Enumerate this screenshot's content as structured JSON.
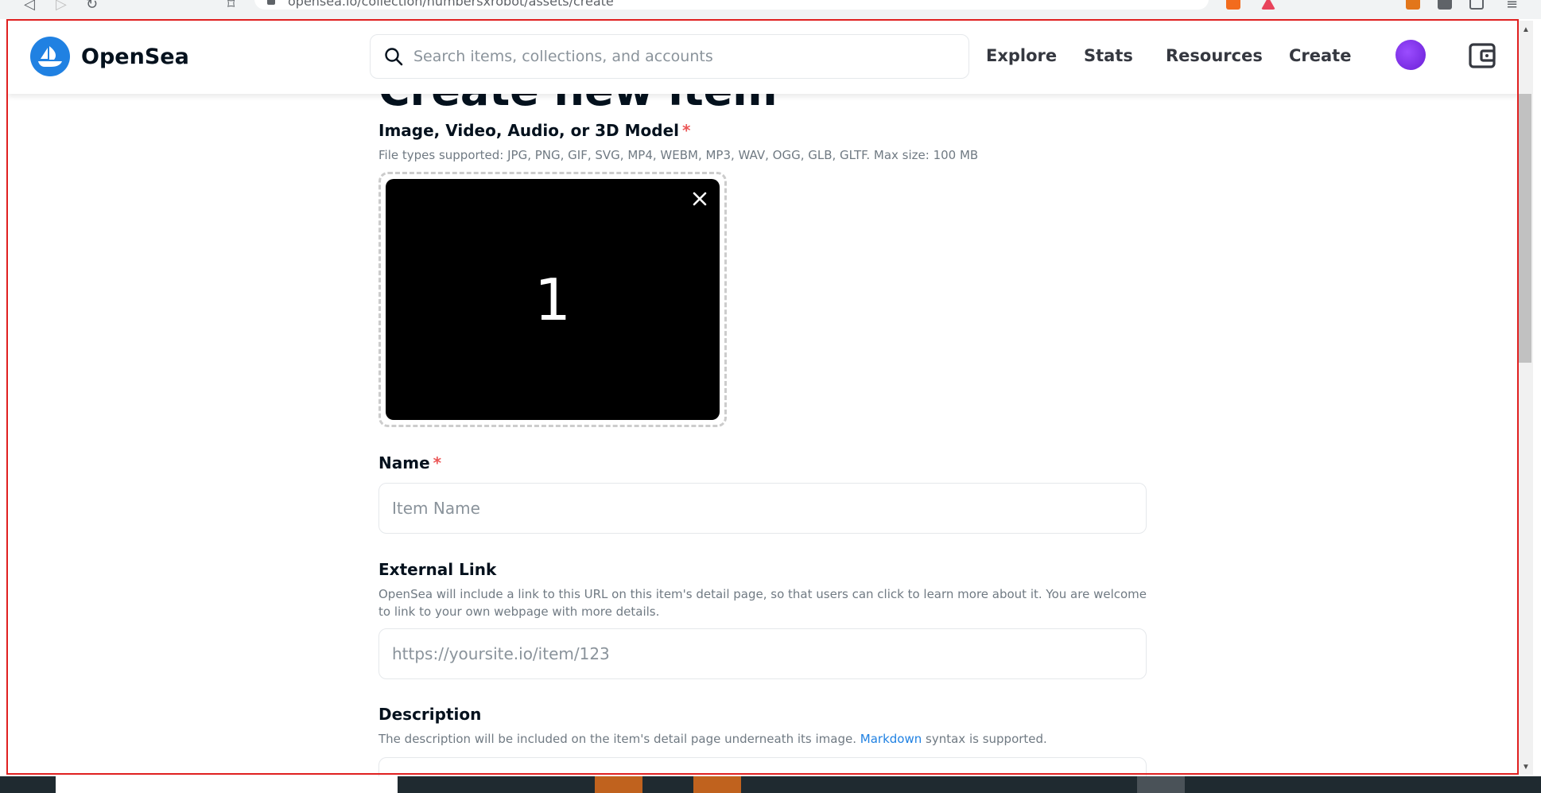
{
  "browser": {
    "url": "opensea.io/collection/numbersxrobot/assets/create"
  },
  "header": {
    "brand": "OpenSea",
    "search_placeholder": "Search items, collections, and accounts",
    "nav": [
      {
        "label": "Explore"
      },
      {
        "label": "Stats"
      },
      {
        "label": "Resources"
      },
      {
        "label": "Create"
      }
    ]
  },
  "page": {
    "title": "Create new item",
    "media": {
      "label": "Image, Video, Audio, or 3D Model",
      "required_mark": "*",
      "help": "File types supported: JPG, PNG, GIF, SVG, MP4, WEBM, MP3, WAV, OGG, GLB, GLTF. Max size: 100 MB",
      "preview_text": "1"
    },
    "name": {
      "label": "Name",
      "required_mark": "*",
      "placeholder": "Item Name",
      "value": ""
    },
    "external_link": {
      "label": "External Link",
      "help": "OpenSea will include a link to this URL on this item's detail page, so that users can click to learn more about it. You are welcome to link to your own webpage with more details.",
      "placeholder": "https://yoursite.io/item/123",
      "value": ""
    },
    "description": {
      "label": "Description",
      "help_before": "The description will be included on the item's detail page underneath its image.",
      "help_link": "Markdown",
      "help_after": "syntax is supported."
    }
  },
  "colors": {
    "brand_blue": "#2081e2",
    "required_red": "#eb5757",
    "annotation_red": "#e02020"
  }
}
